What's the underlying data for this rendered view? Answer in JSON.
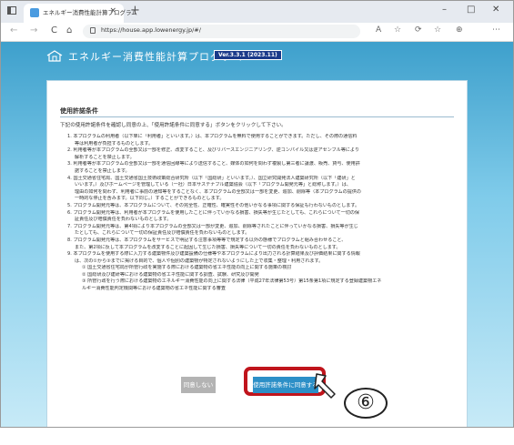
{
  "browser": {
    "tab_title": "エネルギー消費性能計算プログラム",
    "tab_close": "×",
    "new_tab": "+",
    "url": "https://house.app.lowenergy.jp/#/",
    "controls": {
      "minimize": "–",
      "maximize": "□",
      "close": "✕"
    },
    "nav": {
      "back": "←",
      "forward": "→",
      "refresh": "C",
      "home": "⌂"
    },
    "toolbar_icons": [
      "A",
      "☆",
      "⟳",
      "☆",
      "⊕",
      "⋯"
    ]
  },
  "app": {
    "title": "エネルギー消費性能計算プログラム",
    "version": "Ver.3.3.1 (2023.11)"
  },
  "license": {
    "section_title": "使用許諾条件",
    "intro": "下記の使用許諾条件を確認し同意の上、「使用許諾条件に同意する」ボタンをクリックして下さい。",
    "terms": [
      {
        "kind": "head",
        "text": "1. 本プログラムの利用者（以下単に「利用者」といいます。）は、本プログラムを無料で使用することができます。ただし、その際の通信料"
      },
      {
        "kind": "sub",
        "text": "等は利用者が負担するものとします。"
      },
      {
        "kind": "head",
        "text": "2. 利用者等が本プログラムの全部又は一部を修正、改変すること、及びリバースエンジニアリング、逆コンパイル又は逆アセンブル等により"
      },
      {
        "kind": "sub",
        "text": "解析することを禁止します。"
      },
      {
        "kind": "head",
        "text": "3. 利用者等が本プログラムの全部又は一部を通信回線等により送信すること、媒体の如何を問わず複製し第三者に譲渡、販売、貸与、使用許"
      },
      {
        "kind": "sub",
        "text": "諾することを禁止します。"
      },
      {
        "kind": "head",
        "text": "4. 国土交通省住宅局、国土交通省国土技術政策総合研究所（以下「国総研」といいます。）、国立研究開発法人建築研究所（以下「建研」と"
      },
      {
        "kind": "sub",
        "text": "いいます。）及びホームページを管理している（一社）日本サステナブル建築協会（以下「プログラム開発元等」と総称します。）は、"
      },
      {
        "kind": "sub",
        "text": "理由の如何を問わず、利用者に事前の通知等をすることなく、本プログラムの全部又は一部を変更、追加、削除等（本プログラムの提供の"
      },
      {
        "kind": "sub",
        "text": "一時的な停止を含みます。以下同じ。）することができるものとします。"
      },
      {
        "kind": "head",
        "text": "5. プログラム開発元等は、本プログラムについて、その完全性、正確性、確実性その他いかなる事項に関する保証も行わないものとします。"
      },
      {
        "kind": "head",
        "text": "6. プログラム開発元等は、利用者が本プログラムを使用したことに伴っていかなる損害、損失等が生じたとしても、これらについて一切の保"
      },
      {
        "kind": "sub",
        "text": "証責任及び賠償責任を負わないものとします。"
      },
      {
        "kind": "head",
        "text": "7. プログラム開発元等は、第4項により本プログラムの全部又は一部が変更、追加、削除等されたことに伴っていかなる損害、損失等が生じ"
      },
      {
        "kind": "sub",
        "text": "たとしても、これらについて一切の保証責任及び賠償責任を負わないものとします。"
      },
      {
        "kind": "head",
        "text": "8. プログラム開発元等は、本プログラムをサービスで明記する注意事項等等で規定する以外の態様でプログラムと組み合わせること、"
      },
      {
        "kind": "sub",
        "text": "また、第2項に反して本プログラムを改変することに起因して生じた損害、損失等について一切の責任を負わないものとします。"
      },
      {
        "kind": "head",
        "text": "9. 本プログラムを使用する際に入力する建築物件及び建築設備の仕様等や本プログラムにより出力される計算結果及び評価結果に関する情報"
      },
      {
        "kind": "sub",
        "text": "は、次の①から③までに掲げる目的で、個人や個別の建築物が特定されないようにした上で収集・整理・利用されます。"
      },
      {
        "kind": "item",
        "text": "① 国土交通省住宅局が所管行政を実施する際における建築物の省エネ性能の向上に関する施策の検討"
      },
      {
        "kind": "item",
        "text": "② 国総研及び建研等における建築物の省エネ性能に関する調査、試験、研究及び開発"
      },
      {
        "kind": "item",
        "text": "③ 所管行政を行う際における建築物のエネルギー消費性能の向上に関する法律（平成27年法律第53号）第15条第1項に規定する登録建築物エネ"
      },
      {
        "kind": "item",
        "text": "ルギー消費性能判定機関等における建築物の省エネ性能に関する審査"
      }
    ],
    "decline_label": "同意しない",
    "agree_label": "使用許諾条件に同意する"
  },
  "annotation": {
    "step": "⑥"
  }
}
